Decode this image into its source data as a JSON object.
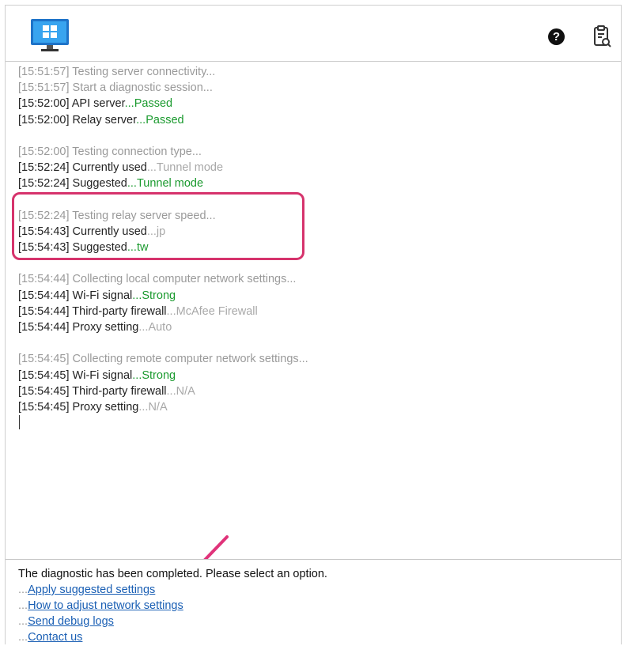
{
  "toolbar": {
    "logo_icon": "monitor-windows-icon",
    "help_glyph": "?",
    "help_icon": "question-circle-icon",
    "report_icon": "clipboard-wrench-icon"
  },
  "log": {
    "lines": [
      {
        "ts": "[15:51:57]",
        "msg": "Testing server connectivity...",
        "status": "",
        "muted": true
      },
      {
        "ts": "[15:51:57]",
        "msg": "Start a diagnostic session...",
        "status": "",
        "muted": true
      },
      {
        "ts": "[15:52:00]",
        "msg": "API server",
        "status": "...Passed",
        "status_type": "ok"
      },
      {
        "ts": "[15:52:00]",
        "msg": "Relay server",
        "status": "...Passed",
        "status_type": "ok"
      },
      {
        "gap": true
      },
      {
        "ts": "[15:52:00]",
        "msg": "Testing connection type...",
        "status": "",
        "muted": true
      },
      {
        "ts": "[15:52:24]",
        "msg": "Currently used",
        "status": "...Tunnel mode",
        "status_type": "muted"
      },
      {
        "ts": "[15:52:24]",
        "msg": "Suggested",
        "status": "...Tunnel mode",
        "status_type": "ok"
      },
      {
        "gap": true
      },
      {
        "ts": "[15:52:24]",
        "msg": "Testing relay server speed...",
        "status": "",
        "muted": true
      },
      {
        "ts": "[15:54:43]",
        "msg": "Currently used",
        "status": "...jp",
        "status_type": "muted"
      },
      {
        "ts": "[15:54:43]",
        "msg": "Suggested",
        "status": "...tw",
        "status_type": "ok"
      },
      {
        "gap": true
      },
      {
        "ts": "[15:54:44]",
        "msg": "Collecting local computer network settings...",
        "status": "",
        "muted": true
      },
      {
        "ts": "[15:54:44]",
        "msg": "Wi-Fi signal",
        "status": "...Strong",
        "status_type": "ok"
      },
      {
        "ts": "[15:54:44]",
        "msg": "Third-party firewall",
        "status": "...McAfee Firewall",
        "status_type": "muted"
      },
      {
        "ts": "[15:54:44]",
        "msg": "Proxy setting",
        "status": "...Auto",
        "status_type": "muted"
      },
      {
        "gap": true
      },
      {
        "ts": "[15:54:45]",
        "msg": "Collecting remote computer network settings...",
        "status": "",
        "muted": true
      },
      {
        "ts": "[15:54:45]",
        "msg": "Wi-Fi signal",
        "status": "...Strong",
        "status_type": "ok"
      },
      {
        "ts": "[15:54:45]",
        "msg": "Third-party firewall",
        "status": "...N/A",
        "status_type": "muted"
      },
      {
        "ts": "[15:54:45]",
        "msg": "Proxy setting",
        "status": "...N/A",
        "status_type": "muted"
      }
    ]
  },
  "footer": {
    "message": "The diagnostic has been completed. Please select an option.",
    "options": [
      {
        "prefix": "...",
        "label": "Apply suggested settings"
      },
      {
        "prefix": "...",
        "label": "How to adjust network settings"
      },
      {
        "prefix": "...",
        "label": "Send debug logs"
      },
      {
        "prefix": "...",
        "label": "Contact us"
      }
    ]
  },
  "colors": {
    "ok": "#1a9a2e",
    "muted": "#9a9a9a",
    "link": "#1a5fb4",
    "highlight": "#d6336c"
  }
}
